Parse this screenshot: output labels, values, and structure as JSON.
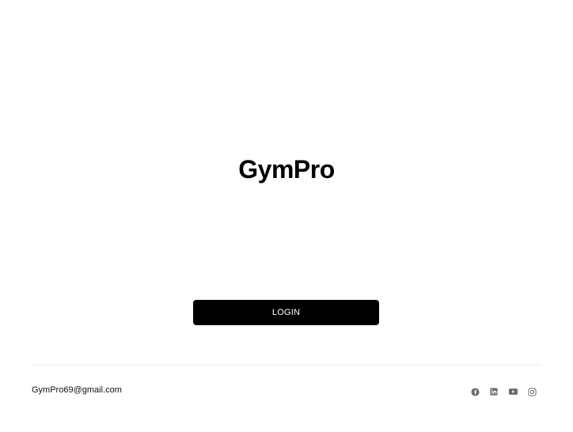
{
  "app": {
    "title": "GymPro"
  },
  "login": {
    "label": "LOGIN"
  },
  "footer": {
    "email": "GymPro69@gmail.com",
    "socials": [
      {
        "icon": "facebook-icon"
      },
      {
        "icon": "linkedin-icon"
      },
      {
        "icon": "youtube-icon"
      },
      {
        "icon": "instagram-icon"
      }
    ]
  },
  "colors": {
    "background": "#ffffff",
    "primary": "#000000",
    "icon": "#6b6b6b",
    "divider": "#ececec"
  }
}
